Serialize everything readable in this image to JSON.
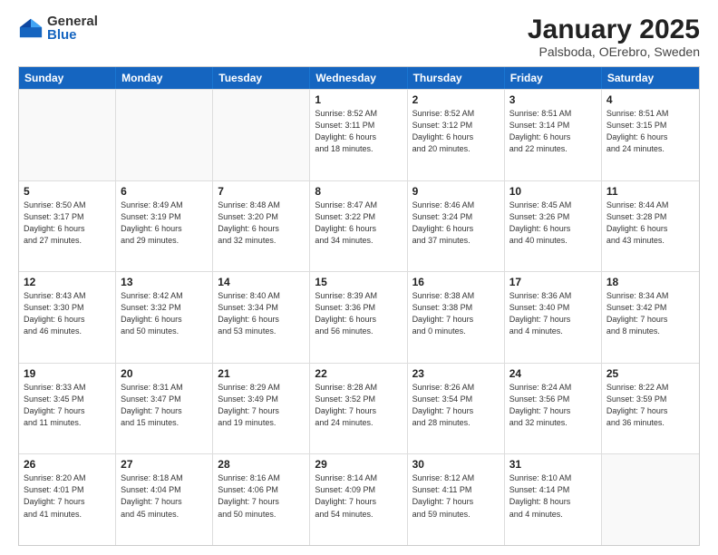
{
  "logo": {
    "general": "General",
    "blue": "Blue"
  },
  "title": "January 2025",
  "subtitle": "Palsboda, OErebro, Sweden",
  "days": [
    "Sunday",
    "Monday",
    "Tuesday",
    "Wednesday",
    "Thursday",
    "Friday",
    "Saturday"
  ],
  "weeks": [
    [
      {
        "day": "",
        "text": ""
      },
      {
        "day": "",
        "text": ""
      },
      {
        "day": "",
        "text": ""
      },
      {
        "day": "1",
        "text": "Sunrise: 8:52 AM\nSunset: 3:11 PM\nDaylight: 6 hours\nand 18 minutes."
      },
      {
        "day": "2",
        "text": "Sunrise: 8:52 AM\nSunset: 3:12 PM\nDaylight: 6 hours\nand 20 minutes."
      },
      {
        "day": "3",
        "text": "Sunrise: 8:51 AM\nSunset: 3:14 PM\nDaylight: 6 hours\nand 22 minutes."
      },
      {
        "day": "4",
        "text": "Sunrise: 8:51 AM\nSunset: 3:15 PM\nDaylight: 6 hours\nand 24 minutes."
      }
    ],
    [
      {
        "day": "5",
        "text": "Sunrise: 8:50 AM\nSunset: 3:17 PM\nDaylight: 6 hours\nand 27 minutes."
      },
      {
        "day": "6",
        "text": "Sunrise: 8:49 AM\nSunset: 3:19 PM\nDaylight: 6 hours\nand 29 minutes."
      },
      {
        "day": "7",
        "text": "Sunrise: 8:48 AM\nSunset: 3:20 PM\nDaylight: 6 hours\nand 32 minutes."
      },
      {
        "day": "8",
        "text": "Sunrise: 8:47 AM\nSunset: 3:22 PM\nDaylight: 6 hours\nand 34 minutes."
      },
      {
        "day": "9",
        "text": "Sunrise: 8:46 AM\nSunset: 3:24 PM\nDaylight: 6 hours\nand 37 minutes."
      },
      {
        "day": "10",
        "text": "Sunrise: 8:45 AM\nSunset: 3:26 PM\nDaylight: 6 hours\nand 40 minutes."
      },
      {
        "day": "11",
        "text": "Sunrise: 8:44 AM\nSunset: 3:28 PM\nDaylight: 6 hours\nand 43 minutes."
      }
    ],
    [
      {
        "day": "12",
        "text": "Sunrise: 8:43 AM\nSunset: 3:30 PM\nDaylight: 6 hours\nand 46 minutes."
      },
      {
        "day": "13",
        "text": "Sunrise: 8:42 AM\nSunset: 3:32 PM\nDaylight: 6 hours\nand 50 minutes."
      },
      {
        "day": "14",
        "text": "Sunrise: 8:40 AM\nSunset: 3:34 PM\nDaylight: 6 hours\nand 53 minutes."
      },
      {
        "day": "15",
        "text": "Sunrise: 8:39 AM\nSunset: 3:36 PM\nDaylight: 6 hours\nand 56 minutes."
      },
      {
        "day": "16",
        "text": "Sunrise: 8:38 AM\nSunset: 3:38 PM\nDaylight: 7 hours\nand 0 minutes."
      },
      {
        "day": "17",
        "text": "Sunrise: 8:36 AM\nSunset: 3:40 PM\nDaylight: 7 hours\nand 4 minutes."
      },
      {
        "day": "18",
        "text": "Sunrise: 8:34 AM\nSunset: 3:42 PM\nDaylight: 7 hours\nand 8 minutes."
      }
    ],
    [
      {
        "day": "19",
        "text": "Sunrise: 8:33 AM\nSunset: 3:45 PM\nDaylight: 7 hours\nand 11 minutes."
      },
      {
        "day": "20",
        "text": "Sunrise: 8:31 AM\nSunset: 3:47 PM\nDaylight: 7 hours\nand 15 minutes."
      },
      {
        "day": "21",
        "text": "Sunrise: 8:29 AM\nSunset: 3:49 PM\nDaylight: 7 hours\nand 19 minutes."
      },
      {
        "day": "22",
        "text": "Sunrise: 8:28 AM\nSunset: 3:52 PM\nDaylight: 7 hours\nand 24 minutes."
      },
      {
        "day": "23",
        "text": "Sunrise: 8:26 AM\nSunset: 3:54 PM\nDaylight: 7 hours\nand 28 minutes."
      },
      {
        "day": "24",
        "text": "Sunrise: 8:24 AM\nSunset: 3:56 PM\nDaylight: 7 hours\nand 32 minutes."
      },
      {
        "day": "25",
        "text": "Sunrise: 8:22 AM\nSunset: 3:59 PM\nDaylight: 7 hours\nand 36 minutes."
      }
    ],
    [
      {
        "day": "26",
        "text": "Sunrise: 8:20 AM\nSunset: 4:01 PM\nDaylight: 7 hours\nand 41 minutes."
      },
      {
        "day": "27",
        "text": "Sunrise: 8:18 AM\nSunset: 4:04 PM\nDaylight: 7 hours\nand 45 minutes."
      },
      {
        "day": "28",
        "text": "Sunrise: 8:16 AM\nSunset: 4:06 PM\nDaylight: 7 hours\nand 50 minutes."
      },
      {
        "day": "29",
        "text": "Sunrise: 8:14 AM\nSunset: 4:09 PM\nDaylight: 7 hours\nand 54 minutes."
      },
      {
        "day": "30",
        "text": "Sunrise: 8:12 AM\nSunset: 4:11 PM\nDaylight: 7 hours\nand 59 minutes."
      },
      {
        "day": "31",
        "text": "Sunrise: 8:10 AM\nSunset: 4:14 PM\nDaylight: 8 hours\nand 4 minutes."
      },
      {
        "day": "",
        "text": ""
      }
    ]
  ]
}
